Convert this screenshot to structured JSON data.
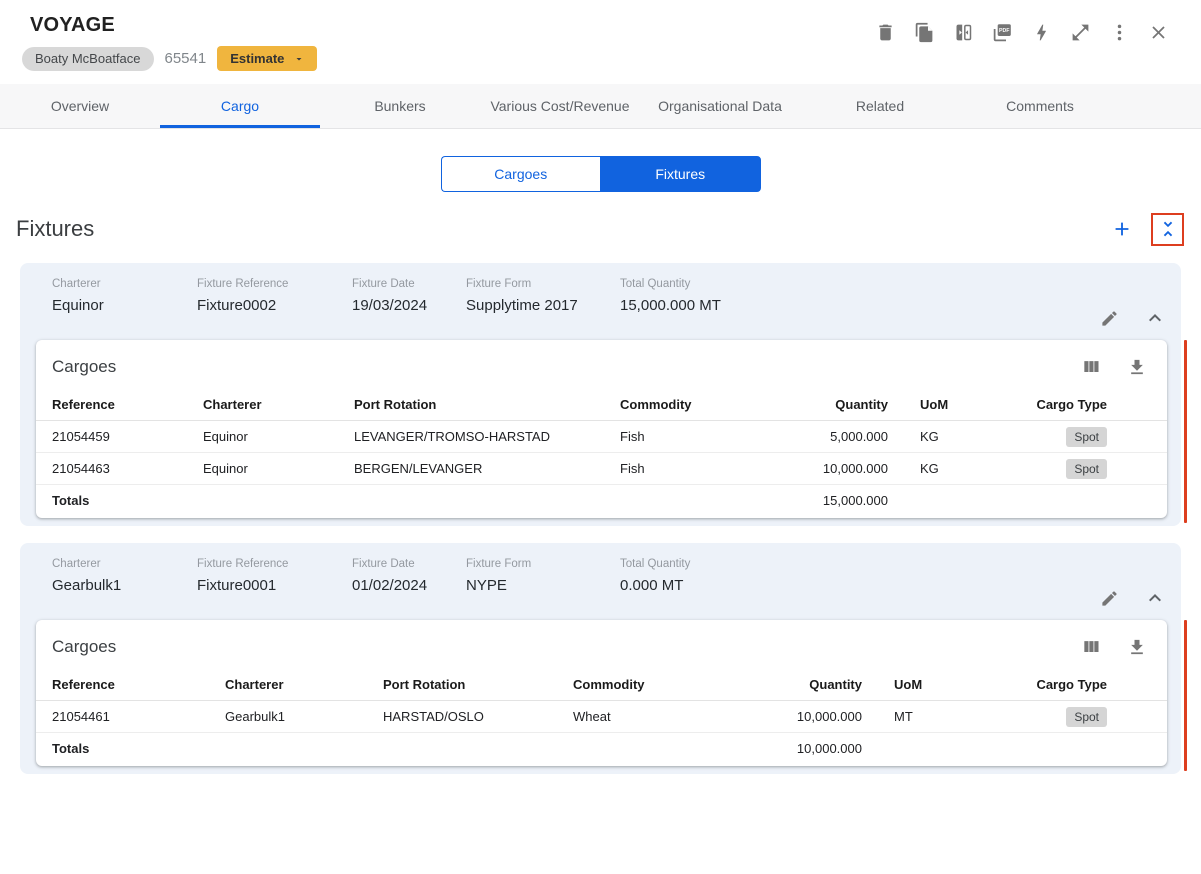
{
  "window": {
    "title": "VOYAGE",
    "vessel_name": "Boaty McBoatface",
    "voyage_number": "65541",
    "estimate_button_label": "Estimate",
    "toolbar_icons": [
      "delete-icon",
      "duplicate-icon",
      "compare-icon",
      "pdf-icon",
      "quick-actions-icon",
      "expand-icon",
      "more-options-icon",
      "close-icon"
    ]
  },
  "tabs": [
    {
      "label": "Overview",
      "active": false
    },
    {
      "label": "Cargo",
      "active": true
    },
    {
      "label": "Bunkers",
      "active": false
    },
    {
      "label": "Various Cost/Revenue",
      "active": false
    },
    {
      "label": "Organisational Data",
      "active": false
    },
    {
      "label": "Related",
      "active": false
    },
    {
      "label": "Comments",
      "active": false
    }
  ],
  "view_toggle": {
    "options": [
      {
        "label": "Cargoes",
        "selected": false
      },
      {
        "label": "Fixtures",
        "selected": true
      }
    ]
  },
  "section": {
    "title": "Fixtures"
  },
  "field_labels": {
    "charterer": "Charterer",
    "fixture_reference": "Fixture Reference",
    "fixture_date": "Fixture Date",
    "fixture_form": "Fixture Form",
    "total_quantity": "Total Quantity"
  },
  "fixtures": [
    {
      "charterer": "Equinor",
      "fixture_reference": "Fixture0002",
      "fixture_date": "19/03/2024",
      "fixture_form": "Supplytime 2017",
      "total_quantity": "15,000.000 MT",
      "cargoes": {
        "title": "Cargoes",
        "columns": [
          "Reference",
          "Charterer",
          "Port Rotation",
          "Commodity",
          "Quantity",
          "UoM",
          "Cargo Type"
        ],
        "rows": [
          {
            "reference": "21054459",
            "charterer": "Equinor",
            "port_rotation": "LEVANGER/TROMSO-HARSTAD",
            "commodity": "Fish",
            "quantity": "5,000.000",
            "uom": "KG",
            "cargo_type": "Spot"
          },
          {
            "reference": "21054463",
            "charterer": "Equinor",
            "port_rotation": "BERGEN/LEVANGER",
            "commodity": "Fish",
            "quantity": "10,000.000",
            "uom": "KG",
            "cargo_type": "Spot"
          }
        ],
        "totals_label": "Totals",
        "totals_quantity": "15,000.000"
      }
    },
    {
      "charterer": "Gearbulk1",
      "fixture_reference": "Fixture0001",
      "fixture_date": "01/02/2024",
      "fixture_form": "NYPE",
      "total_quantity": "0.000 MT",
      "cargoes": {
        "title": "Cargoes",
        "columns": [
          "Reference",
          "Charterer",
          "Port Rotation",
          "Commodity",
          "Quantity",
          "UoM",
          "Cargo Type"
        ],
        "rows": [
          {
            "reference": "21054461",
            "charterer": "Gearbulk1",
            "port_rotation": "HARSTAD/OSLO",
            "commodity": "Wheat",
            "quantity": "10,000.000",
            "uom": "MT",
            "cargo_type": "Spot"
          }
        ],
        "totals_label": "Totals",
        "totals_quantity": "10,000.000"
      }
    }
  ],
  "colors": {
    "accent_blue": "#1163df",
    "card_bg": "#edf2f9",
    "highlight_red": "#dd3e1f",
    "amber": "#f0b53e",
    "icon_gray": "#757575",
    "pill_gray": "#d8d8d8",
    "spot_bg": "#d5d5d5"
  }
}
